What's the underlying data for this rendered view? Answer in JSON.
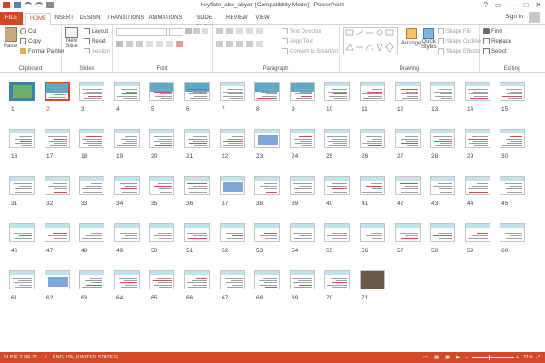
{
  "window": {
    "title": "keyfiate_abe_abyari [Compatibility Mode] - PowerPoint",
    "controls": [
      "?",
      "▭",
      "—",
      "□",
      "✕"
    ]
  },
  "tabs": {
    "file": "FILE",
    "items": [
      "HOME",
      "INSERT",
      "DESIGN",
      "TRANSITIONS",
      "ANIMATIONS",
      "SLIDE SHOW",
      "REVIEW",
      "VIEW"
    ],
    "active": "HOME",
    "signin": "Sign in"
  },
  "ribbon": {
    "clipboard": {
      "label": "Clipboard",
      "paste": "Paste",
      "cut": "Cut",
      "copy": "Copy",
      "format_painter": "Format Painter"
    },
    "slides": {
      "label": "Slides",
      "new_slide": "New",
      "new_slide2": "Slide",
      "layout": "Layout",
      "reset": "Reset",
      "section": "Section"
    },
    "font": {
      "label": "Font"
    },
    "paragraph": {
      "label": "Paragraph",
      "text_direction": "Text Direction",
      "align_text": "Align Text",
      "convert": "Convert to SmartArt"
    },
    "drawing": {
      "label": "Drawing",
      "arrange": "Arrange",
      "quick_styles": "Quick",
      "quick_styles2": "Styles",
      "shape_fill": "Shape Fill",
      "shape_outline": "Shape Outline",
      "shape_effects": "Shape Effects"
    },
    "editing": {
      "label": "Editing",
      "find": "Find",
      "replace": "Replace",
      "select": "Select"
    }
  },
  "slides": {
    "selected": "2",
    "numbers": [
      "1",
      "2",
      "3",
      "4",
      "5",
      "6",
      "7",
      "8",
      "9",
      "10",
      "11",
      "12",
      "13",
      "14",
      "15",
      "16",
      "17",
      "18",
      "19",
      "20",
      "21",
      "22",
      "23",
      "24",
      "25",
      "26",
      "27",
      "28",
      "29",
      "30",
      "31",
      "32",
      "33",
      "34",
      "35",
      "36",
      "37",
      "38",
      "39",
      "40",
      "41",
      "42",
      "43",
      "44",
      "45",
      "46",
      "47",
      "48",
      "49",
      "50",
      "51",
      "52",
      "53",
      "54",
      "55",
      "56",
      "57",
      "58",
      "59",
      "60",
      "61",
      "62",
      "63",
      "64",
      "65",
      "66",
      "67",
      "68",
      "69",
      "70",
      "71"
    ]
  },
  "status": {
    "slide": "SLIDE 2 OF 71",
    "language": "ENGLISH (UNITED STATES)",
    "zoom": "21%"
  },
  "colors": {
    "accent": "#d24726"
  }
}
